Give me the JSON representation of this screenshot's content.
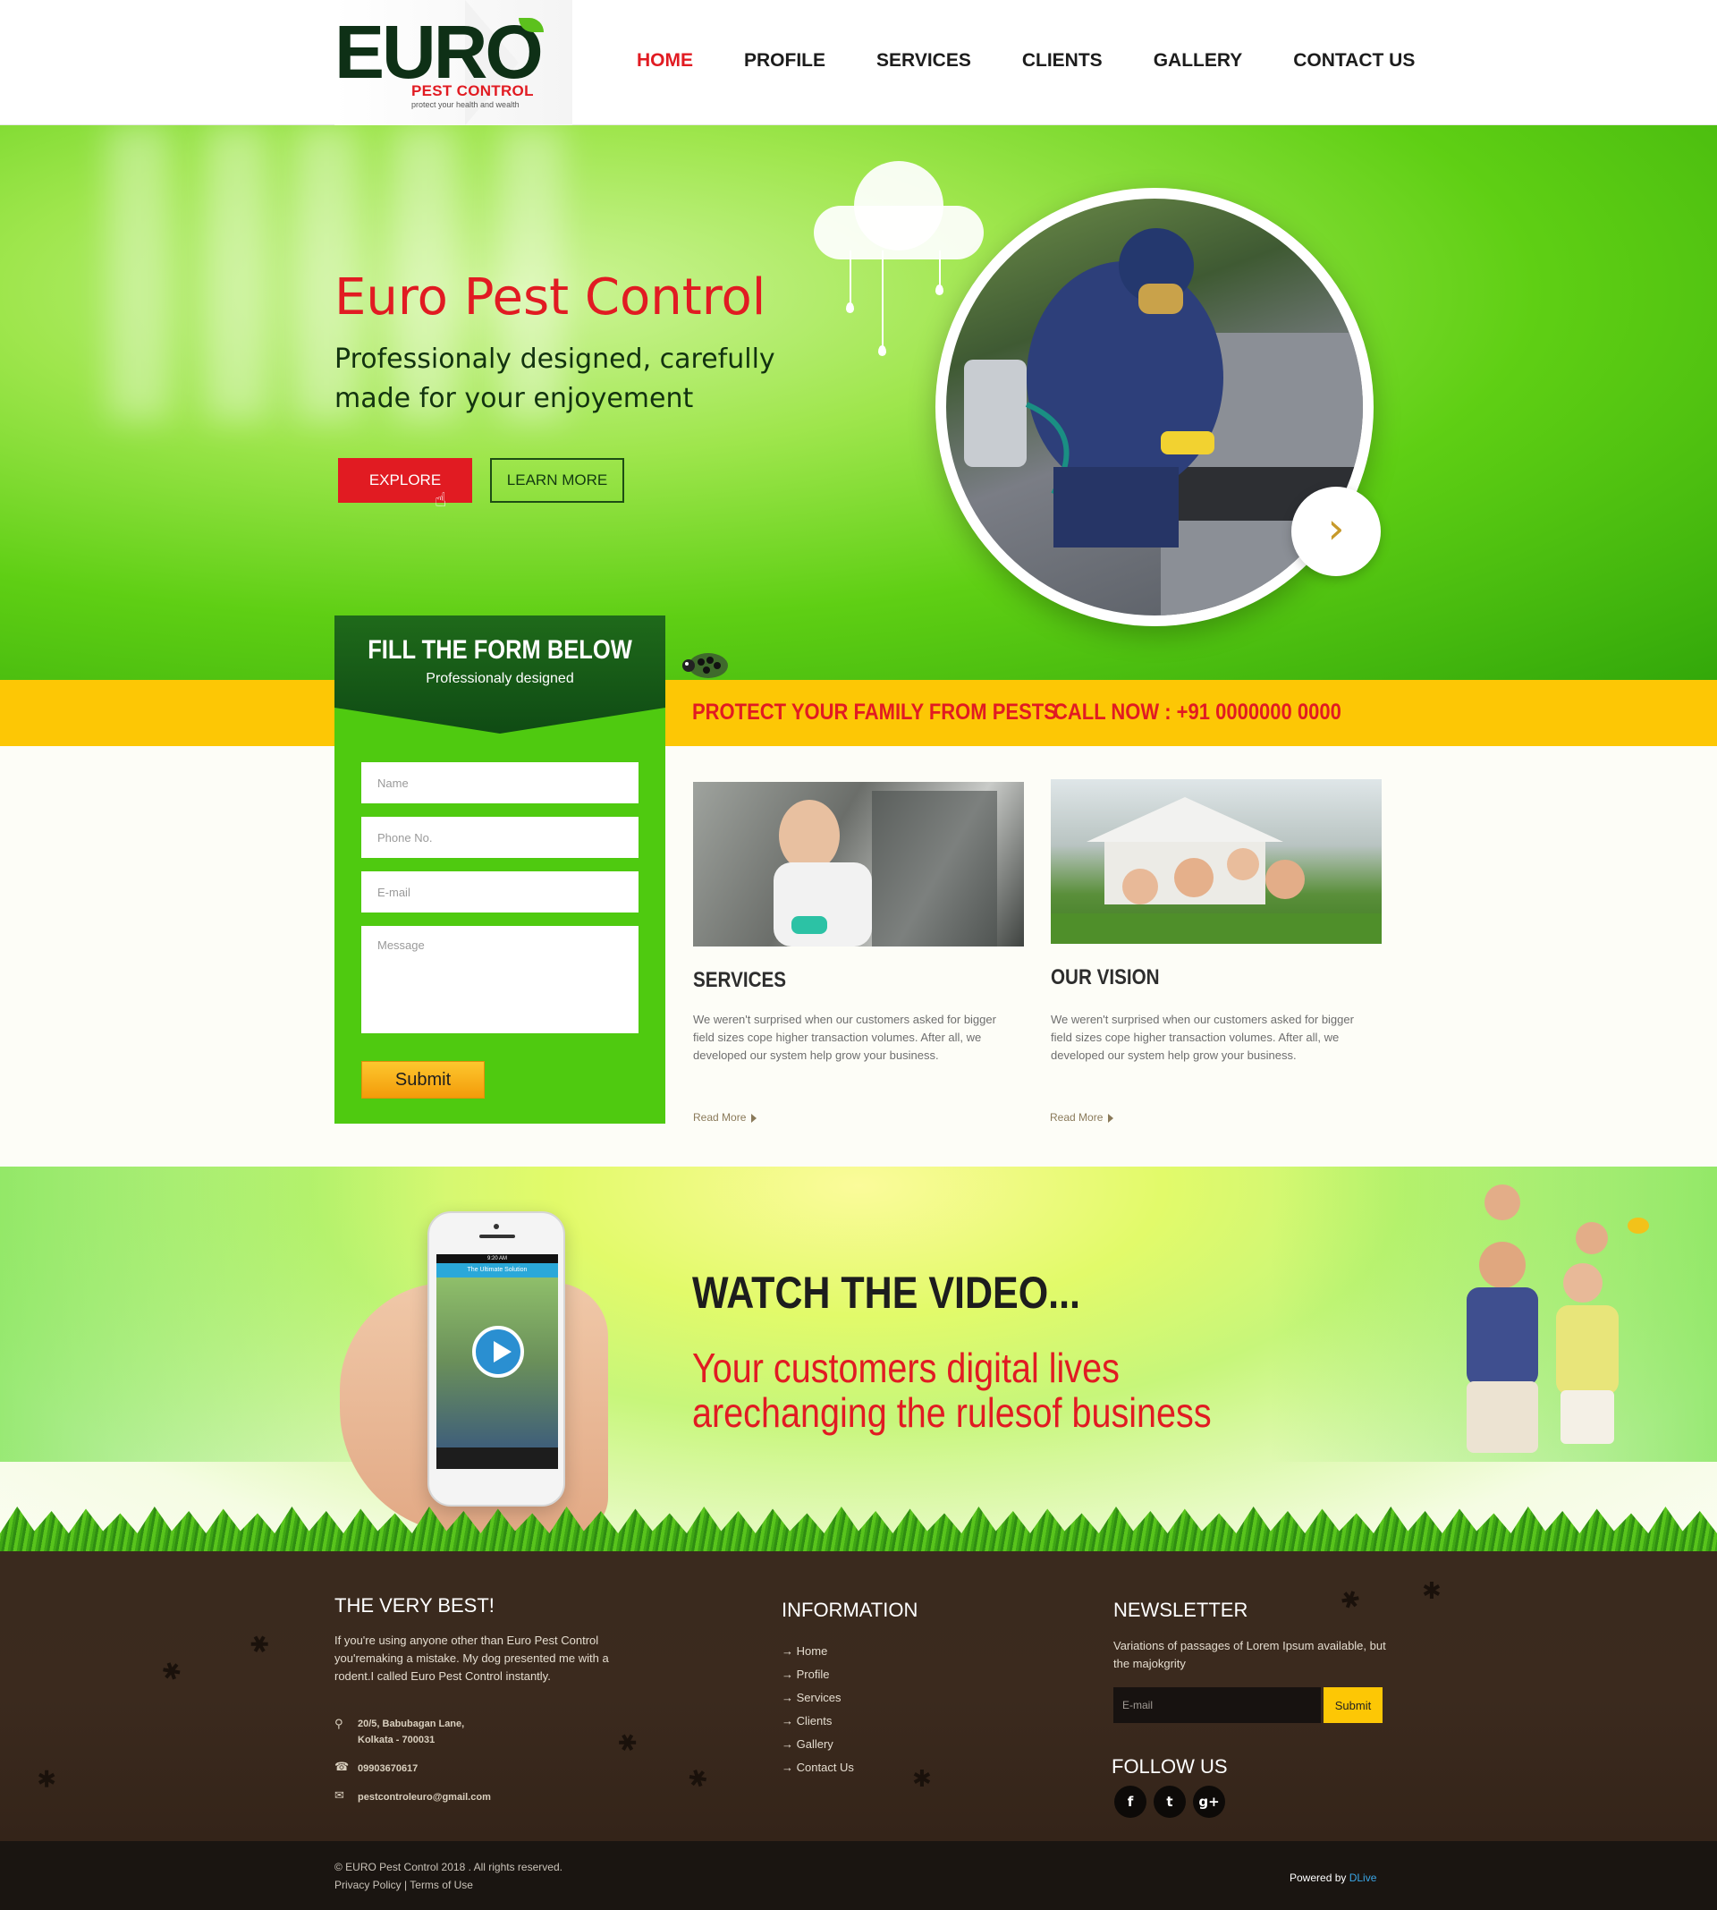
{
  "brand": {
    "logo_main": "EURO",
    "logo_sub": "PEST CONTROL",
    "tagline": "protect your health and wealth",
    "colors": {
      "red": "#e11b22",
      "green": "#4fca10",
      "dark_green": "#0e3016",
      "yellow": "#fdc705",
      "footer_brown": "#3a2a1e"
    }
  },
  "nav": {
    "items": [
      "HOME",
      "PROFILE",
      "SERVICES",
      "CLIENTS",
      "GALLERY",
      "CONTACT US"
    ],
    "active": "HOME"
  },
  "hero": {
    "title": "Euro Pest Control",
    "subtitle": "Professionaly designed, carefully made for your enjoyement",
    "explore_label": "EXPLORE",
    "learn_label": "LEARN MORE",
    "next_icon": "chevron-right-icon"
  },
  "banner": {
    "protect": "PROTECT YOUR FAMILY FROM PESTS",
    "call": "CALL NOW : +91 0000000 0000"
  },
  "form": {
    "title": "FILL THE FORM BELOW",
    "subtitle": "Professionaly designed",
    "name_placeholder": "Name",
    "phone_placeholder": "Phone No.",
    "email_placeholder": "E-mail",
    "message_placeholder": "Message",
    "submit_label": "Submit"
  },
  "cards": [
    {
      "title": "SERVICES",
      "text": "We weren't surprised when our customers asked for bigger field sizes cope higher transaction volumes. After all, we developed our system help grow your business.",
      "more": "Read More"
    },
    {
      "title": "OUR VISION",
      "text": "We weren't surprised when our customers asked for bigger field sizes cope higher transaction volumes. After all, we developed our system help grow your business.",
      "more": "Read More"
    }
  ],
  "video": {
    "title": "WATCH THE VIDEO...",
    "subtitle_line1": "Your customers  digital lives",
    "subtitle_line2": "arechanging  the rulesof business",
    "phone_time": "9:20 AM",
    "phone_app": "The Ultimate Solution"
  },
  "footer": {
    "about_title": "THE VERY BEST!",
    "about_text": "If you're using anyone other than Euro Pest Control you'remaking a mistake. My dog presented me with a rodent.I called Euro Pest Control instantly.",
    "address_line1": "20/5, Babubagan Lane,",
    "address_line2": "Kolkata - 700031",
    "phone": "09903670617",
    "email": "pestcontroleuro@gmail.com",
    "info_title": "INFORMATION",
    "info_links": [
      "Home",
      "Profile",
      "Services",
      "Clients",
      "Gallery",
      "Contact Us"
    ],
    "newsletter_title": "NEWSLETTER",
    "newsletter_text": "Variations of passages of Lorem Ipsum available, but the majokgrity",
    "newsletter_placeholder": "E-mail",
    "newsletter_submit": "Submit",
    "follow_title": "FOLLOW US",
    "social": [
      {
        "name": "facebook-icon",
        "glyph": "f"
      },
      {
        "name": "twitter-icon",
        "glyph": "t"
      },
      {
        "name": "google-plus-icon",
        "glyph": "g+"
      }
    ]
  },
  "bottom": {
    "copyright": "© EURO Pest Control 2018 . All rights reserved.",
    "privacy": "Privacy Policy",
    "terms": "Terms of Use",
    "powered_by": "Powered by",
    "powered_brand": "DLive"
  }
}
